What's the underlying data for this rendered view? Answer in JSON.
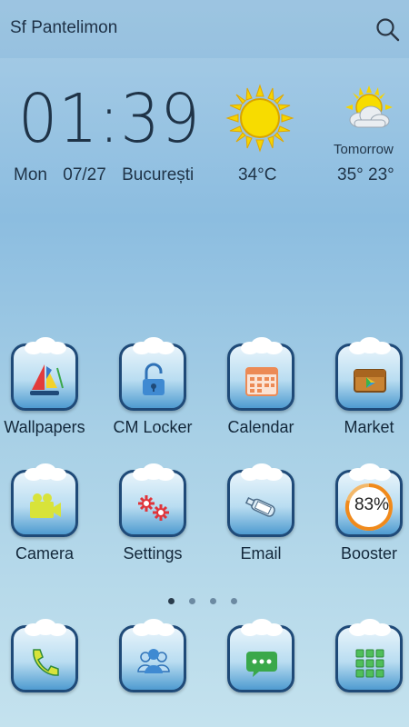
{
  "search": {
    "location": "Sf Pantelimon"
  },
  "clock": {
    "time": "01:39",
    "day": "Mon",
    "date": "07/27",
    "city": "București"
  },
  "weather": {
    "now_temp": "34°C",
    "tomorrow_label": "Tomorrow",
    "tomorrow_temp": "35° 23°"
  },
  "apps_row1": [
    {
      "label": "Wallpapers"
    },
    {
      "label": "CM Locker"
    },
    {
      "label": "Calendar"
    },
    {
      "label": "Market"
    }
  ],
  "apps_row2": [
    {
      "label": "Camera"
    },
    {
      "label": "Settings"
    },
    {
      "label": "Email"
    },
    {
      "label": "Booster",
      "percent": "83%"
    }
  ],
  "dock": [
    {
      "name": "phone"
    },
    {
      "name": "contacts"
    },
    {
      "name": "messages"
    },
    {
      "name": "app-drawer"
    }
  ],
  "pager": {
    "pages": 4,
    "active": 0
  },
  "colors": {
    "tile_border": "#1f4a78",
    "sun": "#f6d400",
    "accent": "#f08a1c"
  }
}
